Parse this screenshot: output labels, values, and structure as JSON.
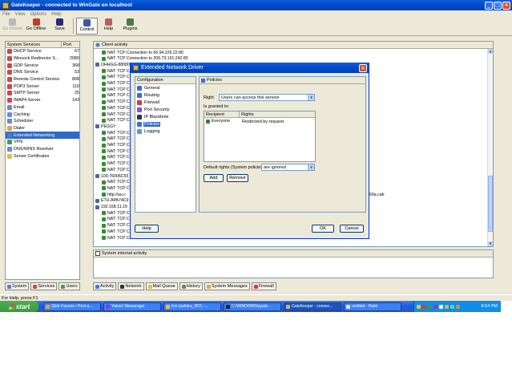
{
  "window": {
    "title": "GateKeeper - connected to WinGate on localhost",
    "buttons": [
      "_",
      "□",
      "×"
    ]
  },
  "menu": [
    "File",
    "View",
    "Options",
    "Help"
  ],
  "toolbar": [
    {
      "label": "Go Online",
      "icon": "go-online-icon",
      "disabled": true
    },
    {
      "label": "Go Offline",
      "icon": "go-offline-icon"
    },
    {
      "label": "Save",
      "icon": "save-icon"
    },
    {
      "label": "Control",
      "icon": "control-icon",
      "pressed": true
    },
    {
      "label": "Help",
      "icon": "help-icon"
    },
    {
      "label": "Plugins",
      "icon": "plugins-icon"
    }
  ],
  "services": {
    "headers": [
      "System Services",
      "Port"
    ],
    "items": [
      {
        "name": "DHCP Service",
        "port": "67",
        "color": "#c84a4a"
      },
      {
        "name": "Winsock Redirector S...",
        "port": "2080",
        "color": "#c84a4a"
      },
      {
        "name": "GDP Service",
        "port": "368",
        "color": "#c84a4a"
      },
      {
        "name": "DNS Service",
        "port": "53",
        "color": "#c84a4a"
      },
      {
        "name": "Remote Control Service",
        "port": "808",
        "color": "#c84a4a"
      },
      {
        "name": "POP3 Server",
        "port": "110",
        "color": "#c84a4a"
      },
      {
        "name": "SMTP Server",
        "port": "25",
        "color": "#c84a4a"
      },
      {
        "name": "IMAP4 Server",
        "port": "143",
        "color": "#c84a4a"
      },
      {
        "name": "Email",
        "port": "",
        "color": "#6a8ad6"
      },
      {
        "name": "Caching",
        "port": "",
        "color": "#6a8ad6"
      },
      {
        "name": "Scheduler",
        "port": "",
        "color": "#6a8ad6"
      },
      {
        "name": "Dialer",
        "port": "",
        "color": "#d6a84a"
      },
      {
        "name": "Extended Networking",
        "port": "",
        "color": "#4a7ad6",
        "selected": true
      },
      {
        "name": "VPN",
        "port": "",
        "color": "#4a9a4a"
      },
      {
        "name": "DNS/WINS Resolver",
        "port": "",
        "color": "#6a8ad6"
      },
      {
        "name": "Server Certificates",
        "port": "",
        "color": "#d6c24a"
      }
    ]
  },
  "left_tabs": [
    "System",
    "Services",
    "Users"
  ],
  "activity": {
    "title": "Client activity",
    "lines": [
      {
        "text": "NAT: TCP Connection to 66.94.226.22:80",
        "level": 1
      },
      {
        "text": "NAT: TCP Connection to 209.73.191.242:80",
        "level": 1
      },
      {
        "text": "OHHGG-88080",
        "level": 0
      },
      {
        "text": "NAT: TCP C",
        "level": 1
      },
      {
        "text": "NAT: TCP C",
        "level": 1
      },
      {
        "text": "NAT: TCP C",
        "level": 1
      },
      {
        "text": "NAT: TCP C",
        "level": 1
      },
      {
        "text": "NAT: TCP C",
        "level": 1
      },
      {
        "text": "NAT: TCP C",
        "level": 1
      },
      {
        "text": "NAT: TCP C",
        "level": 1
      },
      {
        "text": "NAT: TCP C",
        "level": 1
      },
      {
        "text": "NAT: TCP C",
        "level": 1
      },
      {
        "text": "PEGGY",
        "level": 0
      },
      {
        "text": "NAT: TCP C",
        "level": 1
      },
      {
        "text": "NAT: TCP C",
        "level": 1
      },
      {
        "text": "NAT: TCP C",
        "level": 1
      },
      {
        "text": "NAT: TCP C",
        "level": 1
      },
      {
        "text": "NAT: TCP C",
        "level": 1
      },
      {
        "text": "NAT: TCP C",
        "level": 1
      },
      {
        "text": "NAT: TCP C",
        "level": 1
      },
      {
        "text": "109-76006C55",
        "level": 0
      },
      {
        "text": "NAT: TCP C",
        "level": 1
      },
      {
        "text": "NAT: TCP C",
        "level": 1
      },
      {
        "text": "http://au.c",
        "level": 1,
        "tail": "60a.cab"
      },
      {
        "text": "ETU-APA74C9",
        "level": 0
      },
      {
        "text": "192.168.11.19",
        "level": 0
      },
      {
        "text": "NAT: TCP C",
        "level": 1
      },
      {
        "text": "NAT: TCP C",
        "level": 1
      },
      {
        "text": "NAT: TCP C",
        "level": 1
      },
      {
        "text": "NAT: TCP C",
        "level": 1
      },
      {
        "text": "NAT: TCP Connection to 206.251.79.242:80",
        "level": 1
      }
    ]
  },
  "system_activity": "System internal activity",
  "right_tabs": [
    "Activity",
    "Network",
    "Mail Queue",
    "History",
    "System Messages",
    "Firewall"
  ],
  "status": "For Help, press F1",
  "dialog": {
    "title": "Extended Network Driver",
    "config_header": "Configuration",
    "config_items": [
      {
        "label": "General",
        "color": "#3b6bd6"
      },
      {
        "label": "Routing",
        "color": "#3b6bd6"
      },
      {
        "label": "Firewall",
        "color": "#d63b3b"
      },
      {
        "label": "Port Security",
        "color": "#7a5ad6"
      },
      {
        "label": "IP Blackhole",
        "color": "#333333"
      },
      {
        "label": "Policies",
        "color": "#3b6bd6",
        "selected": true
      },
      {
        "label": "Logging",
        "color": "#5a9ad6"
      }
    ],
    "policies": {
      "header": "Policies",
      "right_label": "Right",
      "right_value": "Users can access this service",
      "granted_label": "Is granted to:",
      "columns": [
        "Recipient",
        "Rights"
      ],
      "rows": [
        {
          "recipient": "Everyone",
          "rights": "Restricted by request"
        }
      ],
      "default_label": "Default rights (System policies)",
      "default_value": "are ignored",
      "add": "Add",
      "remove": "Remove"
    },
    "help": "Help",
    "ok": "OK",
    "cancel": "Cancel"
  },
  "taskbar": {
    "start": "start",
    "tasks": [
      {
        "label": "Qbik Forums • Post a...",
        "color": "#f0a030"
      },
      {
        "label": "Yahoo! Messenger",
        "color": "#8a3ad6"
      },
      {
        "label": "Em (ashtiru_357) -...",
        "color": "#f0c030"
      },
      {
        "label": "C:\\WINDOWS\\syste...",
        "color": "#222222"
      },
      {
        "label": "GateKeeper - connec...",
        "color": "#d9b15a",
        "active": true
      },
      {
        "label": "untitled - Paint",
        "color": "#e0e0e0"
      }
    ],
    "clock": "8:54 PM"
  }
}
